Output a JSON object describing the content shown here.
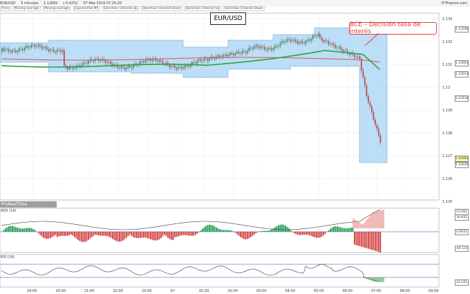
{
  "header": {
    "symbol": "EUR/USD",
    "interval": "5 minutes",
    "last_price": "1.12662",
    "change": "(-0.42%)",
    "datetime": "07-Mar-2019 07:25:25",
    "brand": "IT-Finance.com"
  },
  "indicator_legend": [
    "Price",
    "Moving average",
    "Moving average",
    "Exponential MA",
    "Donchian Channel Up",
    "Donchian Channel Down",
    "Donchian Channel Up",
    "Donchian Channel Down"
  ],
  "chart": {
    "symbol_box": "EUR/USD",
    "annotation": "BCE – Decisión tasa de interés",
    "price_axis": [
      "1.133",
      "1.132",
      "1.131",
      "1.13",
      "1.129",
      "1.128",
      "1.127",
      "1.126",
      "1.125"
    ],
    "price_badges": [
      "1.13296",
      "1.13062",
      "1.13014",
      "1.12918",
      "1.12682",
      "1.12629"
    ],
    "time_axis": [
      "19:00",
      "20:00",
      "21:00",
      "22:00",
      "23:00",
      "07",
      "01:00",
      "02:00",
      "03:00",
      "04:00",
      "05:00",
      "06:00",
      "07:00",
      "08:00",
      "09:00"
    ]
  },
  "branding": "ProRealTime",
  "adx": {
    "title": "ADX (14)",
    "levels": [
      "53.081",
      "40",
      "20",
      "0",
      "-20",
      "-40"
    ],
    "badges": [
      "53.081",
      "30.835",
      "0.6932",
      "-40.131"
    ]
  },
  "rsi": {
    "title": "RSI (14)",
    "levels": [
      "100",
      "70",
      "50",
      "30",
      "0"
    ],
    "badge": "14.245"
  },
  "colors": {
    "channel": "#90c8f0",
    "ema_green": "#2e9e3e",
    "ma_red": "#d9534f",
    "bull": "#1a9a4a",
    "bear": "#d33c3c",
    "annotation": "#e53935"
  }
}
